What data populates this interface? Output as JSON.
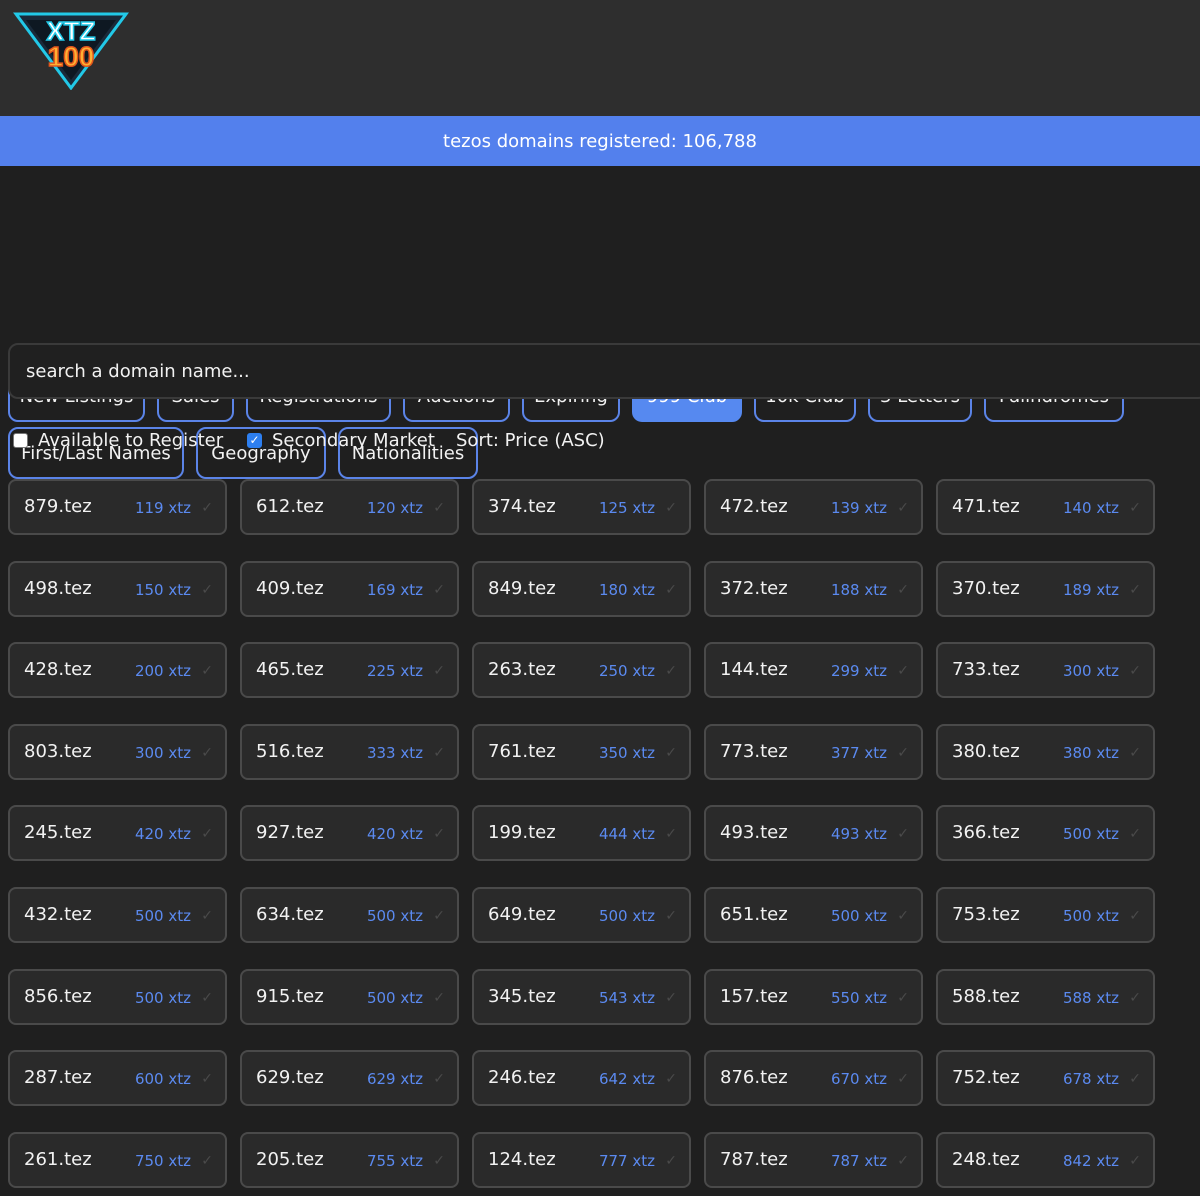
{
  "logo": {
    "line1": "XTZ",
    "line2": "100"
  },
  "banner": {
    "text": "tezos domains registered: 106,788"
  },
  "tabs": [
    {
      "label": "New Listings",
      "active": false
    },
    {
      "label": "Sales",
      "active": false
    },
    {
      "label": "Registrations",
      "active": false
    },
    {
      "label": "Auctions",
      "active": false
    },
    {
      "label": "Expiring",
      "active": false
    },
    {
      "label": "999 Club",
      "active": true
    },
    {
      "label": "10k Club",
      "active": false
    },
    {
      "label": "3 Letters",
      "active": false
    },
    {
      "label": "Palindromes",
      "active": false
    },
    {
      "label": "First/Last Names",
      "active": false
    },
    {
      "label": "Geography",
      "active": false
    },
    {
      "label": "Nationalities",
      "active": false
    }
  ],
  "search": {
    "placeholder": "search a domain name..."
  },
  "filters": {
    "available": {
      "label": "Available to Register",
      "checked": false
    },
    "secondary": {
      "label": "Secondary Market",
      "checked": true
    },
    "sort": "Sort: Price (ASC)"
  },
  "domains": [
    {
      "name": "879.tez",
      "price": "119 xtz"
    },
    {
      "name": "612.tez",
      "price": "120 xtz"
    },
    {
      "name": "374.tez",
      "price": "125 xtz"
    },
    {
      "name": "472.tez",
      "price": "139 xtz"
    },
    {
      "name": "471.tez",
      "price": "140 xtz"
    },
    {
      "name": "498.tez",
      "price": "150 xtz"
    },
    {
      "name": "409.tez",
      "price": "169 xtz"
    },
    {
      "name": "849.tez",
      "price": "180 xtz"
    },
    {
      "name": "372.tez",
      "price": "188 xtz"
    },
    {
      "name": "370.tez",
      "price": "189 xtz"
    },
    {
      "name": "428.tez",
      "price": "200 xtz"
    },
    {
      "name": "465.tez",
      "price": "225 xtz"
    },
    {
      "name": "263.tez",
      "price": "250 xtz"
    },
    {
      "name": "144.tez",
      "price": "299 xtz"
    },
    {
      "name": "733.tez",
      "price": "300 xtz"
    },
    {
      "name": "803.tez",
      "price": "300 xtz"
    },
    {
      "name": "516.tez",
      "price": "333 xtz"
    },
    {
      "name": "761.tez",
      "price": "350 xtz"
    },
    {
      "name": "773.tez",
      "price": "377 xtz"
    },
    {
      "name": "380.tez",
      "price": "380 xtz"
    },
    {
      "name": "245.tez",
      "price": "420 xtz"
    },
    {
      "name": "927.tez",
      "price": "420 xtz"
    },
    {
      "name": "199.tez",
      "price": "444 xtz"
    },
    {
      "name": "493.tez",
      "price": "493 xtz"
    },
    {
      "name": "366.tez",
      "price": "500 xtz"
    },
    {
      "name": "432.tez",
      "price": "500 xtz"
    },
    {
      "name": "634.tez",
      "price": "500 xtz"
    },
    {
      "name": "649.tez",
      "price": "500 xtz"
    },
    {
      "name": "651.tez",
      "price": "500 xtz"
    },
    {
      "name": "753.tez",
      "price": "500 xtz"
    },
    {
      "name": "856.tez",
      "price": "500 xtz"
    },
    {
      "name": "915.tez",
      "price": "500 xtz"
    },
    {
      "name": "345.tez",
      "price": "543 xtz"
    },
    {
      "name": "157.tez",
      "price": "550 xtz"
    },
    {
      "name": "588.tez",
      "price": "588 xtz"
    },
    {
      "name": "287.tez",
      "price": "600 xtz"
    },
    {
      "name": "629.tez",
      "price": "629 xtz"
    },
    {
      "name": "246.tez",
      "price": "642 xtz"
    },
    {
      "name": "876.tez",
      "price": "670 xtz"
    },
    {
      "name": "752.tez",
      "price": "678 xtz"
    },
    {
      "name": "261.tez",
      "price": "750 xtz"
    },
    {
      "name": "205.tez",
      "price": "755 xtz"
    },
    {
      "name": "124.tez",
      "price": "777 xtz"
    },
    {
      "name": "787.tez",
      "price": "787 xtz"
    },
    {
      "name": "248.tez",
      "price": "842 xtz"
    }
  ],
  "colors": {
    "accent": "#5380ed",
    "price": "#5b8af0",
    "background": "#1f1f1f",
    "header": "#2e2e2e"
  }
}
